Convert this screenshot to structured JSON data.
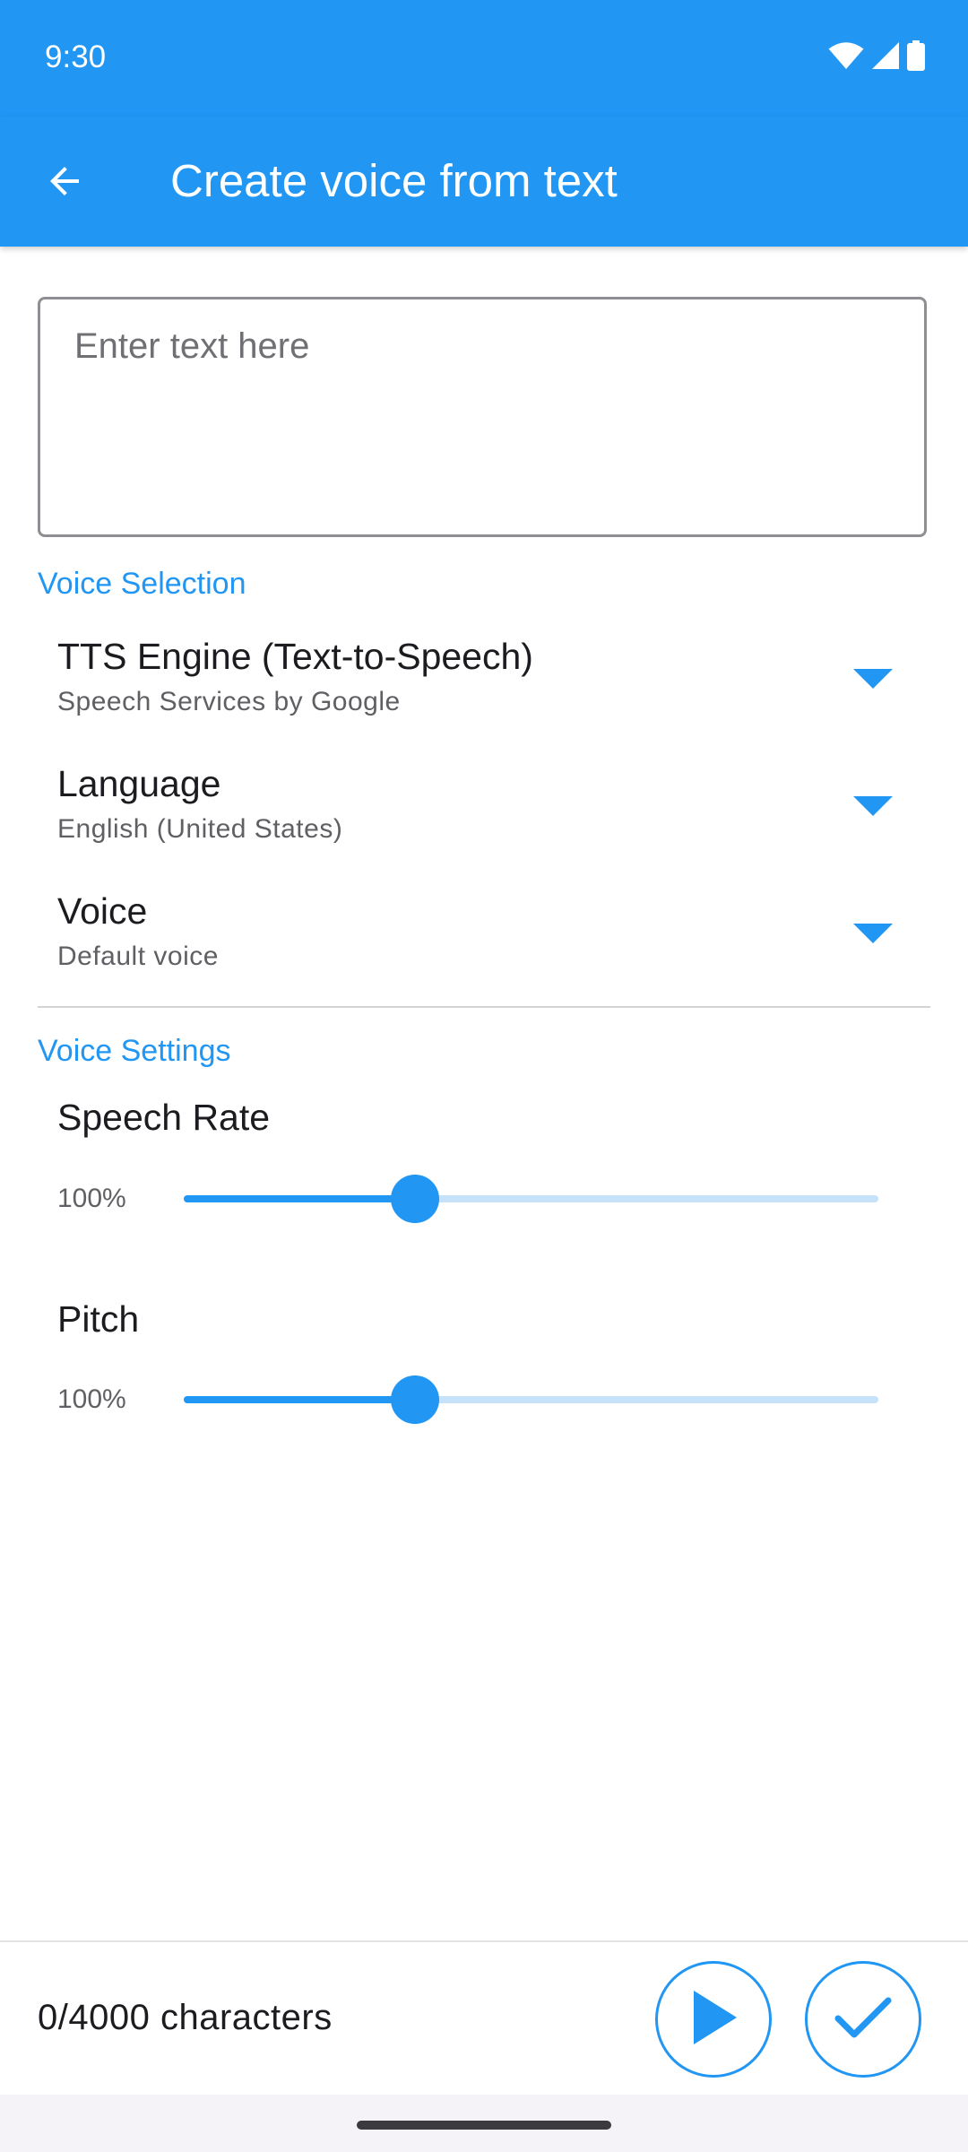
{
  "status_bar": {
    "time": "9:30",
    "icons": [
      "wifi-icon",
      "cellular-signal-icon",
      "battery-icon"
    ]
  },
  "app_bar": {
    "back_icon": "arrow-back-icon",
    "title": "Create voice from text"
  },
  "text_input": {
    "value": "",
    "placeholder": "Enter text here"
  },
  "voice_selection": {
    "header": "Voice Selection",
    "items": [
      {
        "label": "TTS Engine (Text-to-Speech)",
        "value": "Speech Services by Google",
        "icon": "dropdown-arrow-icon"
      },
      {
        "label": "Language",
        "value": "English (United States)",
        "icon": "dropdown-arrow-icon"
      },
      {
        "label": "Voice",
        "value": "Default voice",
        "icon": "dropdown-arrow-icon"
      }
    ]
  },
  "voice_settings": {
    "header": "Voice Settings",
    "speech_rate": {
      "label": "Speech Rate",
      "value_text": "100%",
      "level": 0.333
    },
    "pitch": {
      "label": "Pitch",
      "value_text": "100%",
      "level": 0.333
    }
  },
  "footer": {
    "char_count": "0/4000 characters",
    "play_icon": "play-icon",
    "confirm_icon": "check-icon"
  },
  "colors": {
    "primary": "#2196f3",
    "slider_track_inactive": "#c6e2fb",
    "text_primary": "#1c1b1f",
    "text_secondary": "#5f5f64"
  }
}
